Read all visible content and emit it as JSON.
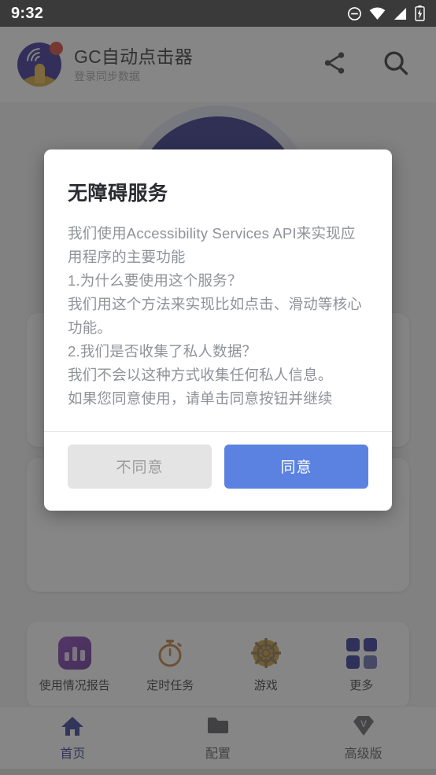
{
  "status_bar": {
    "time": "9:32",
    "icons": [
      "do-not-disturb-icon",
      "wifi-icon",
      "cellular-signal-icon",
      "battery-charging-icon"
    ]
  },
  "app_header": {
    "title": "GC自动点击器",
    "subtitle": "登录同步数据",
    "logo_icon": "app-logo-icon",
    "actions": [
      {
        "name": "share-icon",
        "label": ""
      },
      {
        "name": "search-icon",
        "label": ""
      }
    ]
  },
  "dialog": {
    "title": "无障碍服务",
    "paragraphs": [
      "我们使用Accessibility Services API来实现应用程序的主要功能",
      "1.为什么要使用这个服务？",
      "我们用这个方法来实现比如点击、滑动等核心功能。",
      "2.我们是否收集了私人数据？",
      "我们不会以这种方式收集任何私人信息。",
      "如果您同意使用，请单击同意按钮并继续"
    ],
    "disagree_label": "不同意",
    "agree_label": "同意",
    "agree_color": "#5b82e0",
    "disagree_color": "#e4e4e4"
  },
  "shortcuts": [
    {
      "label": "使用情况报告",
      "icon": "bar-chart-icon",
      "color": "#6a23a6"
    },
    {
      "label": "定时任务",
      "icon": "stopwatch-icon",
      "color": "#c1722a"
    },
    {
      "label": "游戏",
      "icon": "ship-wheel-icon",
      "color": "#c8921e"
    },
    {
      "label": "更多",
      "icon": "grid-icon",
      "color": "#1e208c"
    }
  ],
  "bottom_nav": [
    {
      "label": "首页",
      "icon": "home-icon",
      "active": true
    },
    {
      "label": "配置",
      "icon": "folder-icon",
      "active": false
    },
    {
      "label": "高级版",
      "icon": "diamond-v-icon",
      "active": false
    }
  ]
}
